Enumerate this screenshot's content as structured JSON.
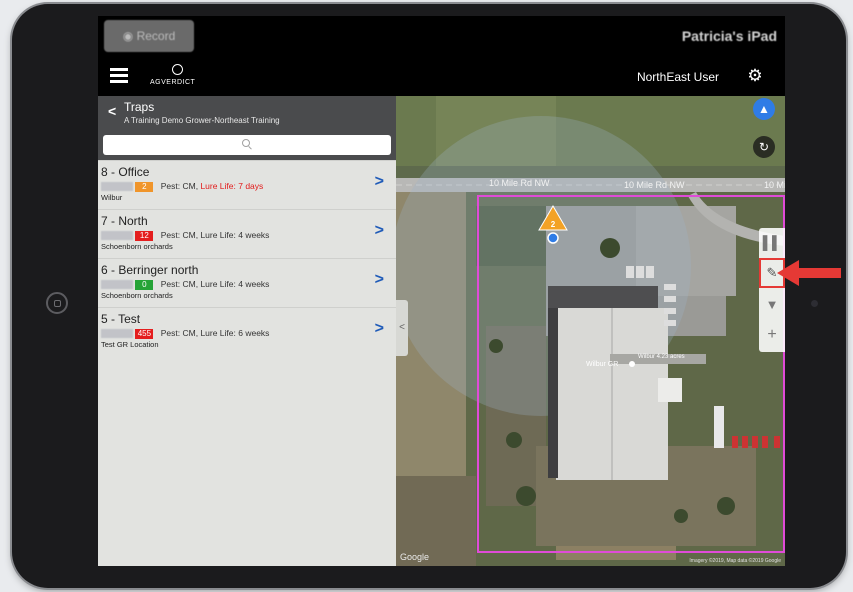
{
  "device": {
    "record_button_label": "Record",
    "device_name": "Patricia's iPad"
  },
  "navbar": {
    "brand_text": "AGVERDICT",
    "user_label": "NorthEast User"
  },
  "sidebar": {
    "title": "Traps",
    "subtitle": "A Training Demo Grower-Northeast Training",
    "search_placeholder": "",
    "traps": [
      {
        "title": "8 - Office",
        "count": "2",
        "badge_color": "#f0952a",
        "pest": "Pest: CM, ",
        "lure": "Lure Life: 7 days",
        "lure_alert": true,
        "location": "Wilbur"
      },
      {
        "title": "7 - North",
        "count": "12",
        "badge_color": "#e41e1e",
        "pest": "Pest: CM, ",
        "lure": "Lure Life: 4 weeks",
        "lure_alert": false,
        "location": "Schoenborn orchards"
      },
      {
        "title": "6 - Berringer north",
        "count": "0",
        "badge_color": "#25a336",
        "pest": "Pest: CM, ",
        "lure": "Lure Life: 4 weeks",
        "lure_alert": false,
        "location": "Schoenborn orchards"
      },
      {
        "title": "5 - Test",
        "count": "455",
        "badge_color": "#e41e1e",
        "pest": "Pest: CM, ",
        "lure": "Lure Life: 6 weeks",
        "lure_alert": false,
        "location": "Test GR Location"
      }
    ]
  },
  "map": {
    "road_labels": [
      "10 Mile Rd NW",
      "10 Mile Rd NW",
      "10 Mile Rd NW",
      "10 Mi"
    ],
    "marker_count": "2",
    "building_label": "Wilbur GR",
    "building_sublabel": "Wilbur\n4.23 acres",
    "attribution": "Google",
    "map_data": "Imagery ©2019, Map data ©2019 Google",
    "colors": {
      "boundary": "#e04bd8",
      "marker": "#f3a225",
      "location_button": "#2f7ce6",
      "highlight": "#e53935"
    }
  },
  "toolbar": {
    "chart_icon": "bar-chart-icon",
    "draw_icon": "edit-note-icon",
    "filter_icon": "filter-icon",
    "add_icon": "plus-icon",
    "chart_glyph": "▌▌",
    "draw_glyph": "✎",
    "filter_glyph": "▼",
    "add_glyph": "+"
  }
}
